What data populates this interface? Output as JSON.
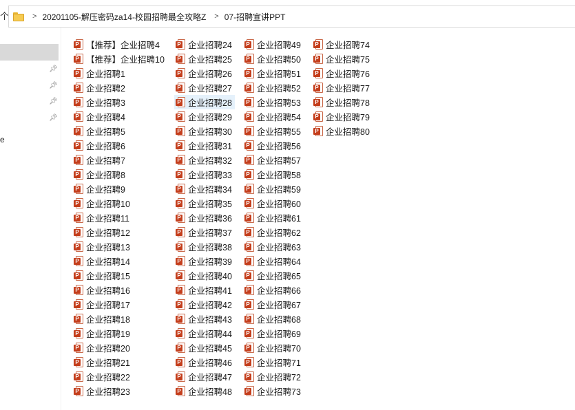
{
  "address_bar": {
    "up_glyph": "个",
    "sep1": ">",
    "crumb1": "20201105-解压密码za14-校园招聘最全攻略Z",
    "sep2": ">",
    "crumb2": "07-招聘宣讲PPT"
  },
  "nav": {
    "truncated_label": "e"
  },
  "file_icon_letter": "P",
  "columns": [
    [
      "【推荐】企业招聘4",
      "【推荐】企业招聘10",
      "企业招聘1",
      "企业招聘2",
      "企业招聘3",
      "企业招聘4",
      "企业招聘5",
      "企业招聘6",
      "企业招聘7",
      "企业招聘8",
      "企业招聘9",
      "企业招聘10",
      "企业招聘11",
      "企业招聘12",
      "企业招聘13",
      "企业招聘14",
      "企业招聘15",
      "企业招聘16",
      "企业招聘17",
      "企业招聘18",
      "企业招聘19",
      "企业招聘20",
      "企业招聘21",
      "企业招聘22",
      "企业招聘23"
    ],
    [
      "企业招聘24",
      "企业招聘25",
      "企业招聘26",
      "企业招聘27",
      "企业招聘28",
      "企业招聘29",
      "企业招聘30",
      "企业招聘31",
      "企业招聘32",
      "企业招聘33",
      "企业招聘34",
      "企业招聘35",
      "企业招聘36",
      "企业招聘37",
      "企业招聘38",
      "企业招聘39",
      "企业招聘40",
      "企业招聘41",
      "企业招聘42",
      "企业招聘43",
      "企业招聘44",
      "企业招聘45",
      "企业招聘46",
      "企业招聘47",
      "企业招聘48"
    ],
    [
      "企业招聘49",
      "企业招聘50",
      "企业招聘51",
      "企业招聘52",
      "企业招聘53",
      "企业招聘54",
      "企业招聘55",
      "企业招聘56",
      "企业招聘57",
      "企业招聘58",
      "企业招聘59",
      "企业招聘60",
      "企业招聘61",
      "企业招聘62",
      "企业招聘63",
      "企业招聘64",
      "企业招聘65",
      "企业招聘66",
      "企业招聘67",
      "企业招聘68",
      "企业招聘69",
      "企业招聘70",
      "企业招聘71",
      "企业招聘72",
      "企业招聘73"
    ],
    [
      "企业招聘74",
      "企业招聘75",
      "企业招聘76",
      "企业招聘77",
      "企业招聘78",
      "企业招聘79",
      "企业招聘80"
    ]
  ],
  "hovered_file": "企业招聘28"
}
